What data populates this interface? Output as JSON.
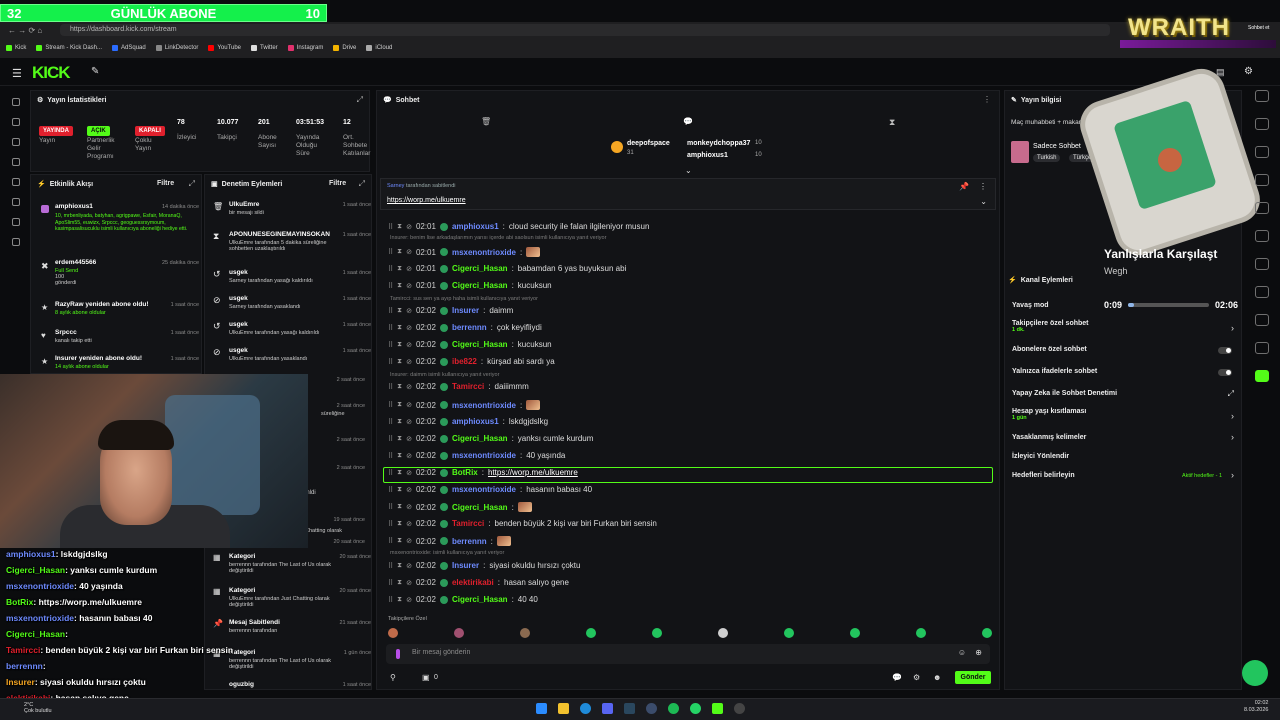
{
  "stream_overlay": {
    "left_number": "32",
    "label": "GÜNLÜK ABONE",
    "right_number": "10"
  },
  "browser": {
    "url": "https://dashboard.kick.com/stream",
    "bookmarks": [
      "Kick",
      "Stream - Kick Dash...",
      "AdSquad",
      "LinkDetector",
      "YouTube",
      "Twitter",
      "Instagram",
      "Drive",
      "iCloud"
    ]
  },
  "wraith": {
    "text": "WRAITH",
    "corner": "Sohbet et"
  },
  "kick": {
    "logo": "KICK"
  },
  "stats": {
    "title": "Yayın İstatistikleri",
    "status_live": "YAYINDA",
    "status_live_lbl": "Yayın",
    "partner": "AÇIK",
    "partner_lbl": "Partnerlik Gelir Programı",
    "multi": "KAPALI",
    "multi_lbl": "Çoklu Yayın",
    "viewers": "78",
    "viewers_lbl": "İzleyici",
    "followers": "10.077",
    "followers_lbl": "Takipçi",
    "subs": "201",
    "subs_lbl": "Abone Sayısı",
    "uptime": "03:51:53",
    "uptime_lbl": "Yayında Olduğu Süre",
    "banned": "12",
    "banned_lbl": "Ort. Sohbete Katılanlar"
  },
  "activity": {
    "title": "Etkinlik Akışı",
    "filter": "Filtre",
    "items": [
      {
        "user": "amphioxus1",
        "time": "14 dakika önce",
        "text": "10, mrbenliyada, batyhan, agrigpawe, Esfair, MoranaQ, ApoSlim55, euwizx, Srpccc, geoguessrsymoum, kasimpasalisucuklu isimli kullanıcıya aboneliği hediye etti."
      },
      {
        "user": "erdem445566",
        "time": "25 dakika önce",
        "text": "Full Send",
        "extra": "100",
        "extra2": "gönderdi"
      },
      {
        "user": "RazyRaw yeniden abone oldu!",
        "time": "1 saat önce",
        "text": "8 aylık abone oldular"
      },
      {
        "user": "Srpccc",
        "time": "1 saat önce",
        "text": "kanalı takip etti"
      },
      {
        "user": "Insurer yeniden abone oldu!",
        "time": "1 saat önce",
        "text": "14 aylık abone oldular"
      }
    ]
  },
  "mod": {
    "title": "Denetim Eylemleri",
    "filter": "Filtre",
    "items": [
      {
        "user": "UlkuEmre",
        "time": "1 saat önce",
        "text": "bir mesajı sildi"
      },
      {
        "user": "APONUNESEGINEMAYINSOKAN",
        "time": "1 saat önce",
        "text": "UlkuEmre tarafından 5 dakika süreliğine sohbetten uzaklaştırıldı"
      },
      {
        "user": "usgek",
        "time": "1 saat önce",
        "text": "Sarney tarafından yasağı kaldırıldı"
      },
      {
        "user": "usgek",
        "time": "1 saat önce",
        "text": "Sarney tarafından yasaklandı"
      },
      {
        "user": "usgek",
        "time": "1 saat önce",
        "text": "UlkuEmre tarafından yasağı kaldırıldı"
      },
      {
        "user": "usgek",
        "time": "1 saat önce",
        "text": "UlkuEmre tarafından yasaklandı"
      },
      {
        "user": "Kategori",
        "time": "20 saat önce",
        "text": "berrennn tarafından The Last of Us olarak değiştirildi"
      },
      {
        "user": "Kategori",
        "time": "20 saat önce",
        "text": "UlkuEmre tarafından Just Chatting olarak değiştirildi"
      },
      {
        "user": "Mesaj Sabitlendi",
        "time": "21 saat önce",
        "text": "berrennn tarafından"
      },
      {
        "user": "Kategori",
        "time": "1 gün önce",
        "text": "berrennn tarafından The Last of Us olarak değiştirildi"
      },
      {
        "user": "oguzbig",
        "time": "1 saat önce",
        "text": ""
      }
    ],
    "partial_times": [
      "2 saat önce",
      "2 saat önce",
      "2 saat önce",
      "2 saat önce",
      "19 saat önce",
      "20 saat önce"
    ],
    "partial_texts": [
      "süreliğine",
      "inldi",
      "Chatting olarak"
    ]
  },
  "chat": {
    "title": "Sohbet",
    "top_users": [
      {
        "user": "deepofspace",
        "count": "31"
      },
      {
        "user": "monkeydchoppa37",
        "count": "10"
      },
      {
        "user": "amphioxus1",
        "count": "10"
      }
    ],
    "pinned": {
      "by": "Sarney",
      "label": "tarafından sabitlendi",
      "link": "https://worp.me/ulkuemre"
    },
    "messages": [
      {
        "time": "02:01",
        "user": "amphioxus1",
        "color": "#6e8bff",
        "text": "cloud security ile falan ilgileniyor musun"
      },
      {
        "reply": "Insurer: benim lise arkadaşlarımın yarısı içerde abi saolsun isimli kullanıcıya yanıt veriyor"
      },
      {
        "time": "02:01",
        "user": "msxenontrioxide",
        "color": "#6e8bff",
        "text": ""
      },
      {
        "time": "02:01",
        "user": "Cigerci_Hasan",
        "color": "#53fc18",
        "text": "babamdan 6 yas buyuksun abi"
      },
      {
        "time": "02:01",
        "user": "Cigerci_Hasan",
        "color": "#53fc18",
        "text": "kucuksun"
      },
      {
        "reply": "Tamircci: sus sen ya ayıp haha isimli kullanıcıya yanıt veriyor"
      },
      {
        "time": "02:02",
        "user": "Insurer",
        "color": "#6e8bff",
        "text": "daimm"
      },
      {
        "time": "02:02",
        "user": "berrennn",
        "color": "#6e8bff",
        "text": "çok keyifliydi"
      },
      {
        "time": "02:02",
        "user": "Cigerci_Hasan",
        "color": "#53fc18",
        "text": "kucuksun"
      },
      {
        "time": "02:02",
        "user": "ibe822",
        "color": "#e0202d",
        "text": "kürşad abi sardı ya"
      },
      {
        "reply": "Insurer: daimm isimli kullanıcıya yanıt veriyor"
      },
      {
        "time": "02:02",
        "user": "Tamircci",
        "color": "#e0202d",
        "text": "daiiimmm"
      },
      {
        "time": "02:02",
        "user": "msxenontrioxide",
        "color": "#6e8bff",
        "text": ""
      },
      {
        "time": "02:02",
        "user": "amphioxus1",
        "color": "#6e8bff",
        "text": "lskdgjdslkg"
      },
      {
        "time": "02:02",
        "user": "Cigerci_Hasan",
        "color": "#53fc18",
        "text": "yanksı cumle kurdum"
      },
      {
        "time": "02:02",
        "user": "msxenontrioxide",
        "color": "#6e8bff",
        "text": "40 yaşında"
      },
      {
        "time": "02:02",
        "user": "BotRix",
        "color": "#53fc18",
        "text": "https://worp.me/ulkuemre"
      },
      {
        "time": "02:02",
        "user": "msxenontrioxide",
        "color": "#6e8bff",
        "text": "hasanın babası 40"
      },
      {
        "time": "02:02",
        "user": "Cigerci_Hasan",
        "color": "#53fc18",
        "text": ""
      },
      {
        "time": "02:02",
        "user": "Tamircci",
        "color": "#e0202d",
        "text": "benden büyük 2 kişi var biri Furkan biri sensin"
      },
      {
        "time": "02:02",
        "user": "berrennn",
        "color": "#6e8bff",
        "text": ""
      },
      {
        "reply": "msxenontrioxide: isimli kullanıcıya yanıt veriyor"
      },
      {
        "time": "02:02",
        "user": "Insurer",
        "color": "#6e8bff",
        "text": "siyasi okuldu hırsızı çoktu"
      },
      {
        "time": "02:02",
        "user": "elektirikabi",
        "color": "#e0202d",
        "text": "hasan salıyo gene"
      },
      {
        "time": "02:02",
        "user": "Cigerci_Hasan",
        "color": "#53fc18",
        "text": "40 40"
      }
    ],
    "emote_label": "Takipçilere Özel",
    "input_placeholder": "Bir mesaj gönderin",
    "count": "0",
    "send": "Gönder"
  },
  "info": {
    "title": "Yayın bilgisi",
    "stream_title": "Maç muhabbeti + makarasy #ad",
    "category": "Sadece Sohbet",
    "tag1": "Turkish",
    "tag2": "Türkçe"
  },
  "player": {
    "title": "Yanlışlarla Karşılaşt",
    "artist": "Wegh",
    "elapsed": "0:09",
    "total": "02:06",
    "progress": 0.07
  },
  "channel_actions": {
    "title": "Kanal Eylemleri",
    "items": [
      {
        "label": "Yavaş mod",
        "sub": ""
      },
      {
        "label": "Takipçilere özel sohbet",
        "sub": "1 dk."
      },
      {
        "label": "Abonelere özel sohbet",
        "sub": ""
      },
      {
        "label": "Yalnızca ifadelerle sohbet",
        "sub": ""
      },
      {
        "label": "Yapay Zeka ile Sohbet Denetimi",
        "sub": ""
      },
      {
        "label": "Hesap yaşı kısıtlaması",
        "sub": "1 gün"
      },
      {
        "label": "Yasaklanmış kelimeler",
        "sub": ""
      },
      {
        "label": "İzleyici Yönlendir",
        "sub": ""
      },
      {
        "label": "Hedefleri belirleyin",
        "sub": "",
        "extra": "Aktif hedefler - 1"
      }
    ]
  },
  "overlay_chat": [
    {
      "user": "amphioxus1",
      "color": "#6e8bff",
      "text": ": lskdgjdslkg"
    },
    {
      "user": "Cigerci_Hasan",
      "color": "#53fc18",
      "text": ": yanksı cumle kurdum"
    },
    {
      "user": "msxenontrioxide",
      "color": "#6e8bff",
      "text": ": 40 yaşında"
    },
    {
      "user": "BotRix",
      "color": "#53fc18",
      "text": ": https://worp.me/ulkuemre"
    },
    {
      "user": "msxenontrioxide",
      "color": "#6e8bff",
      "text": ": hasanın babası 40"
    },
    {
      "user": "Cigerci_Hasan",
      "color": "#53fc18",
      "text": ":"
    },
    {
      "user": "Tamircci",
      "color": "#e0202d",
      "text": ": benden büyük 2 kişi var biri Furkan biri sensin"
    },
    {
      "user": "berrennn",
      "color": "#6e8bff",
      "text": ":"
    },
    {
      "user": "Insurer",
      "color": "#f5a623",
      "text": ": siyasi okuldu hırsızı çoktu"
    },
    {
      "user": "elektirikabi",
      "color": "#e0202d",
      "text": ": hasan salıyo gene"
    }
  ],
  "taskbar": {
    "time": "02:02",
    "date": "8.03.2026",
    "temp": "2°C",
    "weather": "Çok bulutlu"
  }
}
